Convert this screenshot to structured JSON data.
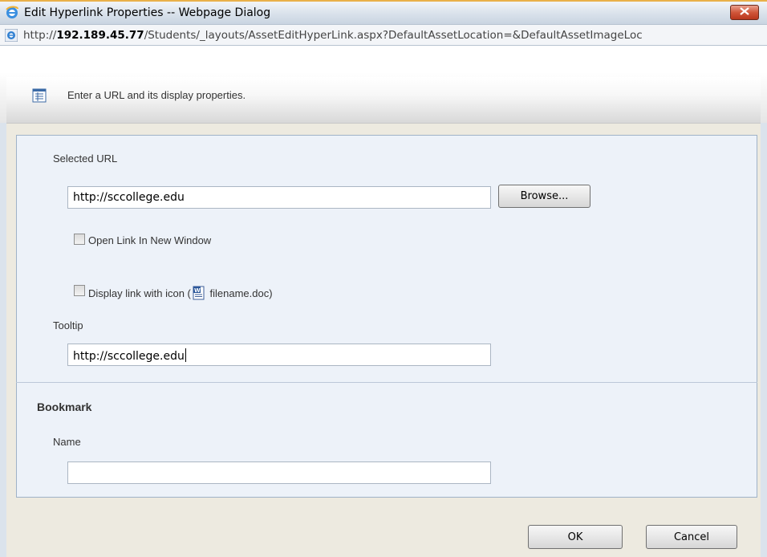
{
  "window": {
    "title": "Edit Hyperlink Properties -- Webpage Dialog",
    "close_icon": "close-icon"
  },
  "address": {
    "url_prefix": "http://",
    "url_host": "192.189.45.77",
    "url_rest": "/Students/_layouts/AssetEditHyperLink.aspx?DefaultAssetLocation=&DefaultAssetImageLoc"
  },
  "info": {
    "text": "Enter a URL and its display properties."
  },
  "form": {
    "selected_url_label": "Selected URL",
    "selected_url_value": "http://sccollege.edu",
    "browse_label": "Browse...",
    "open_new_window_label": "Open Link In New Window",
    "open_new_window_checked": false,
    "display_icon_label_before": "Display link with icon (",
    "display_icon_label_after": " filename.doc)",
    "display_icon_checked": false,
    "tooltip_label": "Tooltip",
    "tooltip_value": "http://sccollege.edu"
  },
  "bookmark": {
    "section_title": "Bookmark",
    "name_label": "Name",
    "name_value": ""
  },
  "footer": {
    "ok_label": "OK",
    "cancel_label": "Cancel"
  },
  "colors": {
    "panel_bg": "#edf2f9",
    "footer_bg": "#edeae0",
    "close_red": "#c8462a"
  }
}
